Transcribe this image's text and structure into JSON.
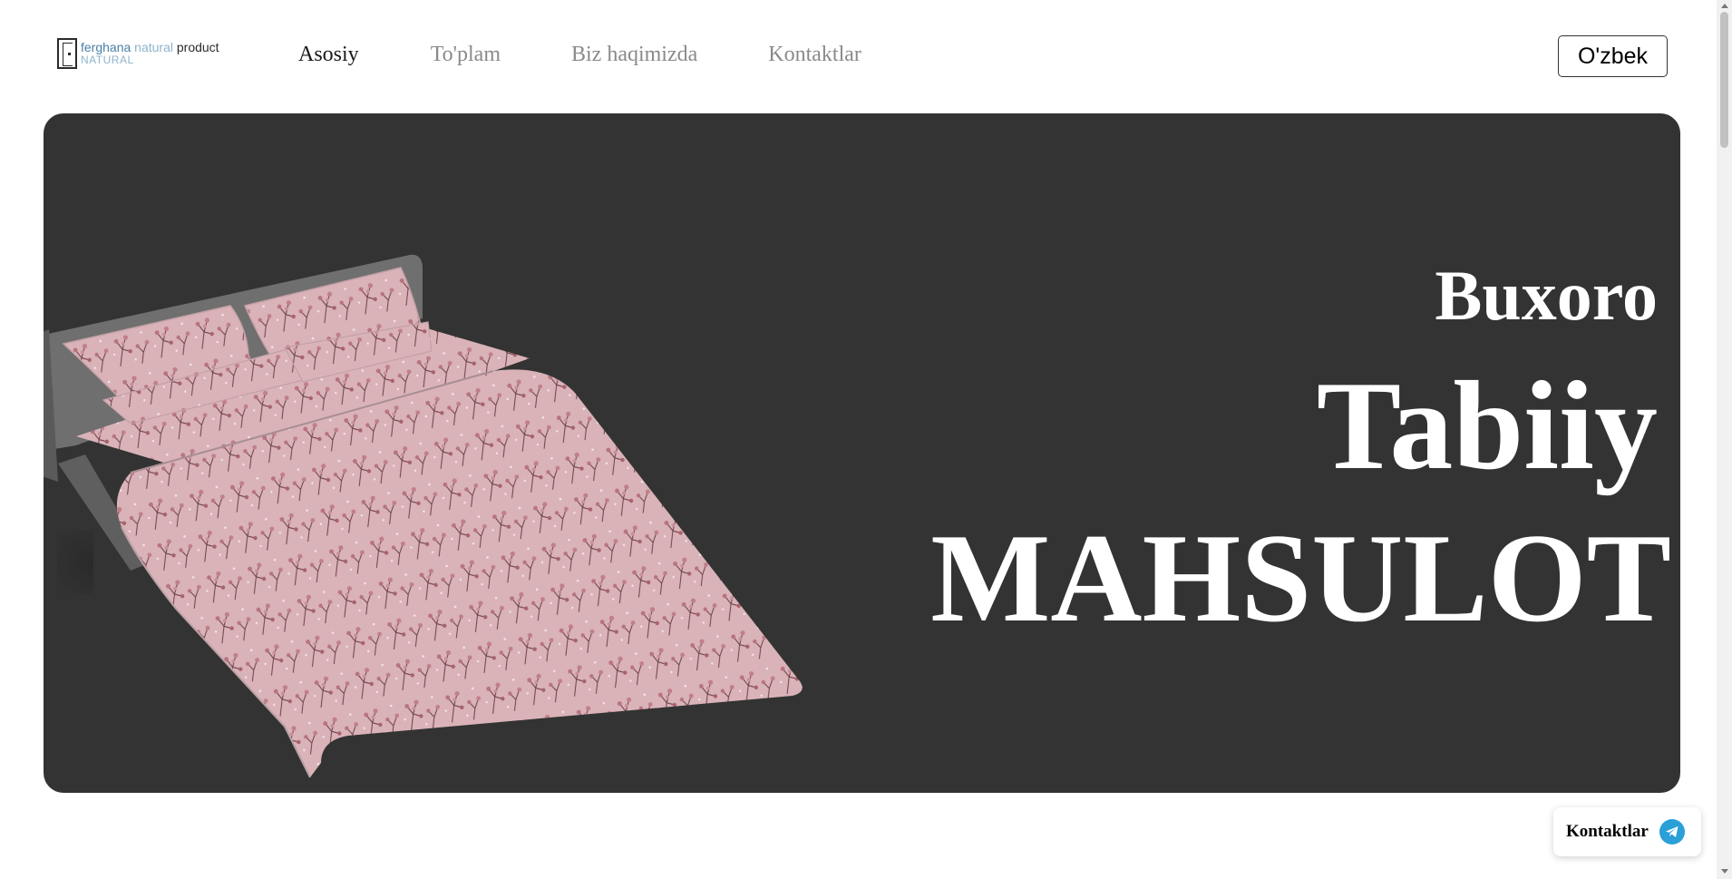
{
  "logo": {
    "brand_part1": "ferghana",
    "brand_part2": " natural",
    "brand_part3": " product",
    "sub": "NATURAL"
  },
  "nav": {
    "home": "Asosiy",
    "collection": "To'plam",
    "about": "Biz haqimizda",
    "contacts": "Kontaktlar"
  },
  "language": {
    "selected": "O'zbek"
  },
  "hero": {
    "line1": "Buxoro",
    "line2": "Tabiiy",
    "line3": "MAHSULOT",
    "image": "bed-with-pink-floral-linen"
  },
  "floating_contact": {
    "label": "Kontaktlar",
    "icon": "telegram-icon"
  },
  "colors": {
    "hero_background": "#333333",
    "nav_active": "#1a1a1a",
    "nav_inactive": "#8a8a8a",
    "telegram": "#2a9fd8",
    "bedding_pink": "#d9b3b8"
  }
}
